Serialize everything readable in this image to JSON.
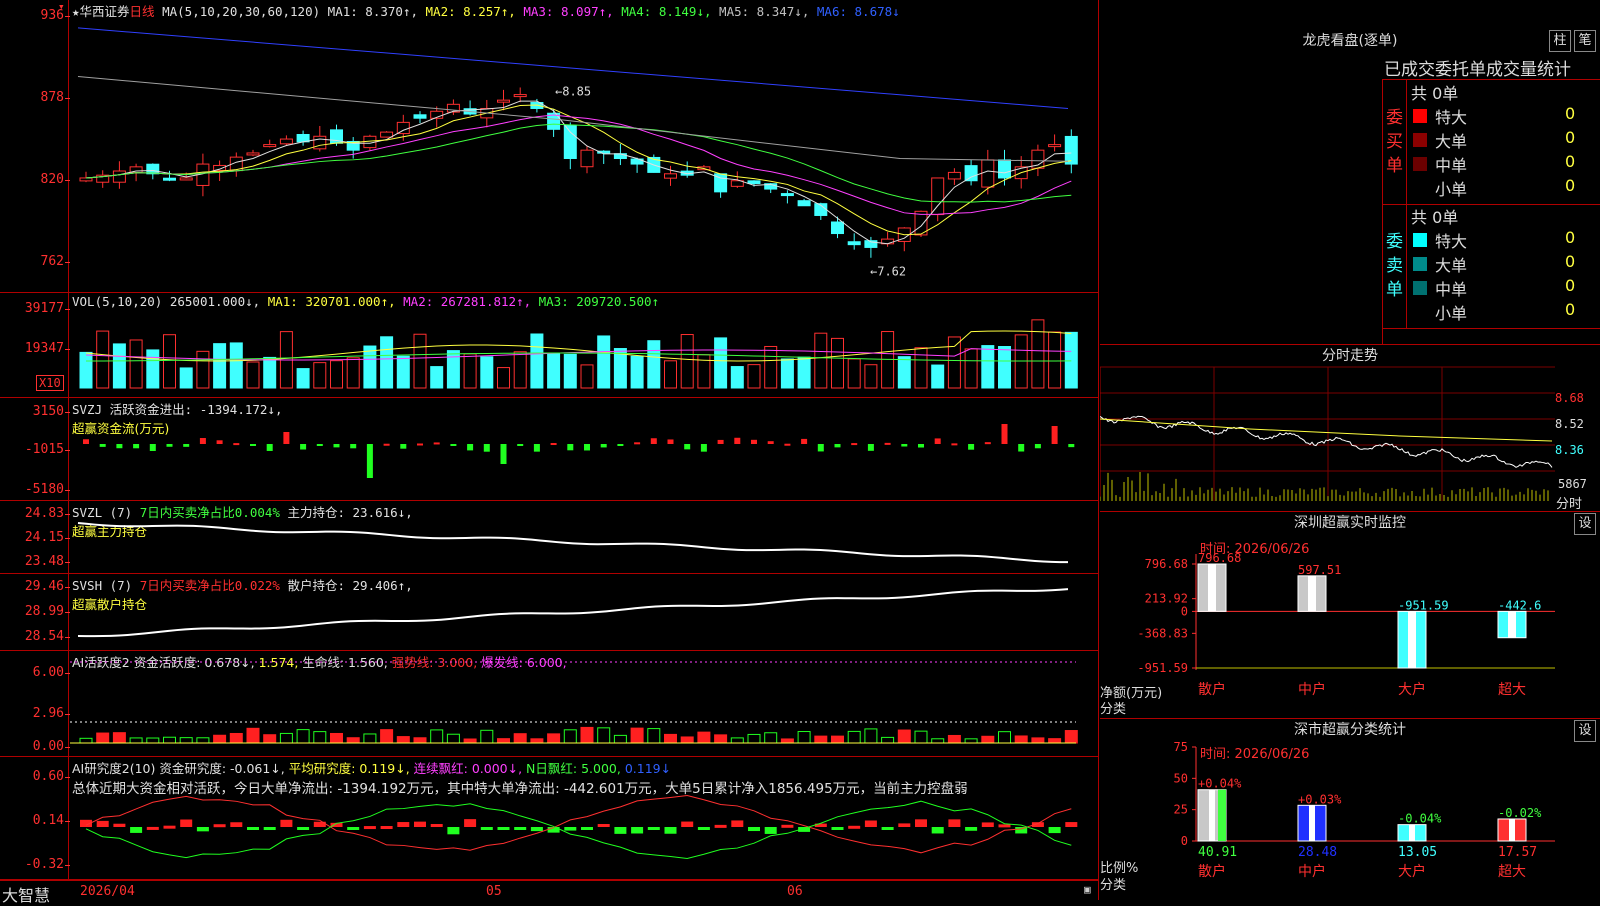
{
  "app": {
    "name": "大智慧",
    "stock_name": "华西证券",
    "period": "日线"
  },
  "candle_pane": {
    "ma_params": "MA(5,10,20,30,60,120)",
    "ma_labels": [
      {
        "text": "MA1: 8.370↑,",
        "color": "#e0e0e0"
      },
      {
        "text": "MA2: 8.257↑,",
        "color": "#ffff40"
      },
      {
        "text": "MA3: 8.097↑,",
        "color": "#ff40ff"
      },
      {
        "text": "MA4: 8.149↓,",
        "color": "#40ff40"
      },
      {
        "text": "MA5: 8.347↓,",
        "color": "#c0c0c0"
      },
      {
        "text": "MA6: 8.678↓",
        "color": "#3060ff"
      }
    ],
    "ticks": [
      "936",
      "878",
      "820",
      "762"
    ],
    "high_label": "8.85",
    "low_label": "7.62",
    "ylim": [
      7.5,
      9.4
    ]
  },
  "vol_pane": {
    "title": "VOL(5,10,20)",
    "labels": [
      {
        "text": "265001.000↓,",
        "color": "#e0e0e0"
      },
      {
        "text": "MA1: 320701.000↑,",
        "color": "#ffff40"
      },
      {
        "text": "MA2: 267281.812↑,",
        "color": "#ff40ff"
      },
      {
        "text": "MA3: 209720.500↑",
        "color": "#40ff40"
      }
    ],
    "ticks": [
      "39177",
      "19347"
    ],
    "unit": "X10"
  },
  "svzj_pane": {
    "title": "SVZJ",
    "labels": [
      {
        "text": "活跃资金进出: -1394.172↓,",
        "color": "#e0e0e0"
      }
    ],
    "sub": "超赢资金流(万元)",
    "ticks": [
      "3150",
      "-1015",
      "-5180"
    ]
  },
  "svzl_pane": {
    "title": "SVZL (7)",
    "labels": [
      {
        "text": "7日内买卖净占比0.004%",
        "color": "#40ff40"
      },
      {
        "text": "主力持仓: 23.616↓,",
        "color": "#e0e0e0"
      }
    ],
    "sub": "超赢主力持仓",
    "ticks": [
      "24.83",
      "24.15",
      "23.48"
    ]
  },
  "svsh_pane": {
    "title": "SVSH (7)",
    "labels": [
      {
        "text": "7日内买卖净占比0.022%",
        "color": "#ff3030"
      },
      {
        "text": "散户持仓: 29.406↑,",
        "color": "#e0e0e0"
      }
    ],
    "sub": "超赢散户持仓",
    "ticks": [
      "29.46",
      "28.99",
      "28.54"
    ]
  },
  "ai_pane": {
    "title": "AI活跃度2",
    "labels": [
      {
        "text": "资金活跃度: 0.678↓,",
        "color": "#e0e0e0"
      },
      {
        "text": "1.574,",
        "color": "#ffff40"
      },
      {
        "text": "生命线: 1.560,",
        "color": "#e0e0e0"
      },
      {
        "text": "强势线: 3.000,",
        "color": "#ff3030"
      },
      {
        "text": "爆发线: 6.000,",
        "color": "#ff40ff"
      }
    ],
    "ticks": [
      "6.00",
      "2.96",
      "0.00"
    ]
  },
  "ai2_pane": {
    "title": "AI研究度2(10)",
    "labels": [
      {
        "text": "资金研究度: -0.061↓,",
        "color": "#e0e0e0"
      },
      {
        "text": "平均研究度: 0.119↓,",
        "color": "#ffff40"
      },
      {
        "text": "连续飘红: 0.000↓,",
        "color": "#ff40ff"
      },
      {
        "text": "N日飘红: 5.000,",
        "color": "#40ff40"
      },
      {
        "text": "0.119↓",
        "color": "#3060ff"
      }
    ],
    "summary": "总体近期大资金相对活跃，今日大单净流出: -1394.192万元，其中特大单净流出: -442.601万元，大单5日累计净入1856.495万元，当前主力控盘弱",
    "ticks": [
      "0.60",
      "0.14",
      "-0.32"
    ]
  },
  "x_axis": {
    "labels": [
      "2026/04",
      "05",
      "06"
    ]
  },
  "longhu": {
    "title": "龙虎看盘(逐单)",
    "btn1": "柱",
    "btn2": "笔",
    "tabs": "已成交委托单成交量统计",
    "buy": {
      "side": [
        "委",
        "买",
        "单"
      ],
      "total": "共 0单",
      "rows": [
        {
          "label": "特大",
          "color": "#ff0000",
          "count": "0",
          "pct": "0%"
        },
        {
          "label": "大单",
          "color": "#8b0000",
          "count": "0",
          "pct": "0%"
        },
        {
          "label": "中单",
          "color": "#6b0000",
          "count": "0",
          "pct": "0%"
        },
        {
          "label": "小单",
          "color": "#000000",
          "count": "0",
          "pct": "0%"
        }
      ]
    },
    "sell": {
      "side": [
        "委",
        "卖",
        "单"
      ],
      "total": "共 0单",
      "rows": [
        {
          "label": "特大",
          "color": "#00ffff",
          "count": "0",
          "pct": "0%"
        },
        {
          "label": "大单",
          "color": "#008b8b",
          "count": "0",
          "pct": "0%"
        },
        {
          "label": "中单",
          "color": "#007070",
          "count": "0",
          "pct": "0%"
        },
        {
          "label": "小单",
          "color": "#000000",
          "count": "0",
          "pct": "0%"
        }
      ]
    }
  },
  "intraday": {
    "title": "分时走势",
    "price_ticks": [
      "8.68",
      "8.52",
      "8.36"
    ],
    "vol_tick": "5867",
    "vol_unit": "分时"
  },
  "sz_monitor": {
    "title": "深圳超赢实时监控",
    "btn": "设",
    "time_label": "时间: 2026/06/26",
    "ticks": [
      "796.68",
      "213.92",
      "0",
      "-368.83",
      "-951.59"
    ],
    "y_label": "净额(万元)",
    "x_label": "分类",
    "chart_data": {
      "type": "bar",
      "categories": [
        "散户",
        "中户",
        "大户",
        "超大"
      ],
      "values": [
        796.68,
        597.51,
        -951.59,
        -442.6
      ],
      "value_labels": [
        "796.68",
        "597.51",
        "-951.59",
        "-442.6"
      ],
      "ylim": [
        -951.59,
        796.68
      ]
    }
  },
  "sz_class": {
    "title": "深市超赢分类统计",
    "btn": "设",
    "time_label": "时间: 2026/06/26",
    "ticks": [
      "75",
      "50",
      "25",
      "0"
    ],
    "y_label": "比例%",
    "x_label": "分类",
    "chart_data": {
      "type": "bar",
      "categories": [
        "散户",
        "中户",
        "大户",
        "超大"
      ],
      "values": [
        40.91,
        28.48,
        13.05,
        17.57
      ],
      "value_labels": [
        "40.91",
        "28.48",
        "13.05",
        "17.57"
      ],
      "change_labels": [
        "+0.04%",
        "+0.03%",
        "-0.04%",
        "-0.02%"
      ],
      "ylim": [
        0,
        75
      ]
    }
  }
}
